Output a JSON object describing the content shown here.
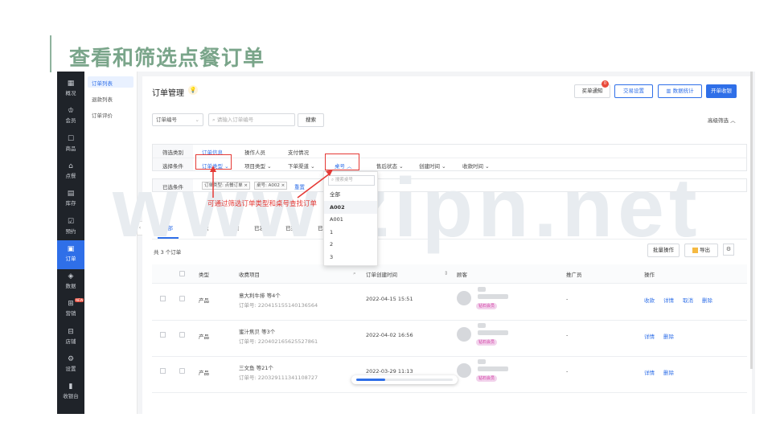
{
  "slide_title": "查看和筛选点餐订单",
  "watermark": "www.zipn.net",
  "sidebar": [
    {
      "icon": "▦",
      "label": "概况"
    },
    {
      "icon": "♔",
      "label": "会员"
    },
    {
      "icon": "☐",
      "label": "商品"
    },
    {
      "icon": "⌂",
      "label": "点餐"
    },
    {
      "icon": "▤",
      "label": "库存"
    },
    {
      "icon": "☑",
      "label": "预约"
    },
    {
      "icon": "▣",
      "label": "订单"
    },
    {
      "icon": "◈",
      "label": "数据"
    },
    {
      "icon": "⊞",
      "label": "营销",
      "badge": "NEW"
    },
    {
      "icon": "⊟",
      "label": "店铺"
    },
    {
      "icon": "⚙",
      "label": "设置"
    },
    {
      "icon": "▮",
      "label": "收银台"
    }
  ],
  "subnav": [
    "订单列表",
    "退款列表",
    "订单评价"
  ],
  "page_title": "订单管理",
  "header_buttons": {
    "notify": "买单通知",
    "notify_badge": "0",
    "trade": "交易设置",
    "stats": "数据统计",
    "cashier": "开单收银"
  },
  "search": {
    "type": "订单编号",
    "placeholder": "请输入订单编号",
    "button": "搜索",
    "advanced": "高级筛选 ︿"
  },
  "filter": {
    "category_label": "筛选类别",
    "categories": [
      "订单信息",
      "操作人员",
      "支付情况"
    ],
    "condition_label": "选择条件",
    "conditions": [
      "订单类型 ⌄",
      "项目类型 ⌄",
      "下单渠道 ⌄",
      "桌号 ︿",
      "售后状态 ⌄",
      "创建时间 ⌄",
      "收款时间 ⌄"
    ],
    "chosen_label": "已选条件",
    "chips": [
      "订单类型: 点餐订单 ×",
      "桌号: A002 ×"
    ],
    "reset": "重置"
  },
  "annotation": "可通过筛选订单类型和桌号查找订单",
  "table_dropdown": {
    "placeholder": "搜索桌号",
    "items": [
      "全部",
      "A002",
      "A001",
      "1",
      "2",
      "3"
    ],
    "selected": "A002"
  },
  "tabs": [
    "全部",
    "待收款",
    "待发货",
    "已发货",
    "已完成",
    "已"
  ],
  "count": "共 3 个订单",
  "tools": {
    "batch": "批量操作",
    "export": "导出",
    "gear": "⚙"
  },
  "columns": [
    "类型",
    "收费项目",
    "订单创建时间",
    "顾客",
    "推广员",
    "操作"
  ],
  "rows": [
    {
      "type": "产品",
      "item": "意大利牛排 等4个",
      "order_no": "订单号: 220415155140136564",
      "time": "2022-04-15 15:51",
      "vip": "钻石会员",
      "promoter": "-",
      "ops": [
        "收款",
        "详情",
        "取消",
        "删除"
      ]
    },
    {
      "type": "产品",
      "item": "蜜汁焦贝 等3个",
      "order_no": "订单号: 220402165625527861",
      "time": "2022-04-02 16:56",
      "vip": "钻石会员",
      "promoter": "-",
      "ops": [
        "详情",
        "删除"
      ]
    },
    {
      "type": "产品",
      "item": "三文鱼 等21个",
      "order_no": "订单号: 220329111341108727",
      "time": "2022-03-29 11:13",
      "vip": "钻石会员",
      "promoter": "-",
      "ops": [
        "详情",
        "删除"
      ]
    }
  ]
}
